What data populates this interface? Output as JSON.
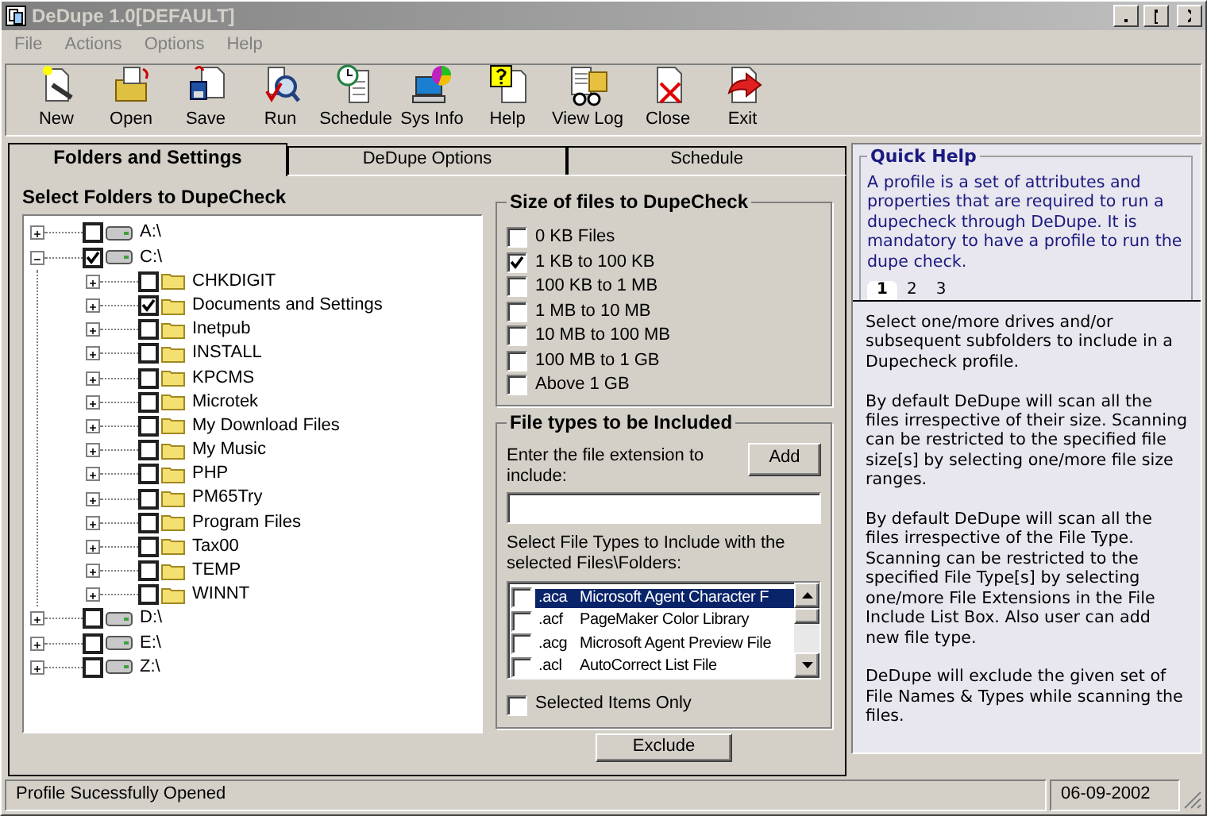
{
  "window": {
    "title": "DeDupe 1.0[DEFAULT]"
  },
  "menu": [
    "File",
    "Actions",
    "Options",
    "Help"
  ],
  "toolbar": [
    {
      "label": "New"
    },
    {
      "label": "Open"
    },
    {
      "label": "Save"
    },
    {
      "label": "Run"
    },
    {
      "label": "Schedule"
    },
    {
      "label": "Sys Info"
    },
    {
      "label": "Help"
    },
    {
      "label": "View Log"
    },
    {
      "label": "Close"
    },
    {
      "label": "Exit"
    }
  ],
  "tabs": [
    {
      "label": "Folders and Settings",
      "selected": true
    },
    {
      "label": "DeDupe Options",
      "selected": false
    },
    {
      "label": "Schedule",
      "selected": false
    }
  ],
  "folders": {
    "title": "Select Folders to DupeCheck",
    "tree": [
      {
        "label": "A:\\",
        "kind": "drive",
        "checked": false,
        "expanded": false
      },
      {
        "label": "C:\\",
        "kind": "drive",
        "checked": true,
        "expanded": true,
        "children": [
          {
            "label": "CHKDIGIT",
            "kind": "folder",
            "checked": false,
            "expanded": false
          },
          {
            "label": "Documents and Settings",
            "kind": "folder",
            "checked": true,
            "expanded": false
          },
          {
            "label": "Inetpub",
            "kind": "folder",
            "checked": false,
            "expanded": false
          },
          {
            "label": "INSTALL",
            "kind": "folder",
            "checked": false,
            "expanded": false
          },
          {
            "label": "KPCMS",
            "kind": "folder",
            "checked": false,
            "expanded": false
          },
          {
            "label": "Microtek",
            "kind": "folder",
            "checked": false,
            "expanded": false
          },
          {
            "label": "My Download Files",
            "kind": "folder",
            "checked": false,
            "expanded": false
          },
          {
            "label": "My Music",
            "kind": "folder",
            "checked": false,
            "expanded": false
          },
          {
            "label": "PHP",
            "kind": "folder",
            "checked": false,
            "expanded": false
          },
          {
            "label": "PM65Try",
            "kind": "folder",
            "checked": false,
            "expanded": false
          },
          {
            "label": "Program Files",
            "kind": "folder",
            "checked": false,
            "expanded": false
          },
          {
            "label": "Tax00",
            "kind": "folder",
            "checked": false,
            "expanded": false
          },
          {
            "label": "TEMP",
            "kind": "folder",
            "checked": false,
            "expanded": false
          },
          {
            "label": "WINNT",
            "kind": "folder",
            "checked": false,
            "expanded": false
          }
        ]
      },
      {
        "label": "D:\\",
        "kind": "drive",
        "checked": false,
        "expanded": false
      },
      {
        "label": "E:\\",
        "kind": "drive",
        "checked": false,
        "expanded": false
      },
      {
        "label": "Z:\\",
        "kind": "drive",
        "checked": false,
        "expanded": false
      }
    ]
  },
  "size_group": {
    "title": "Size of files to DupeCheck",
    "options": [
      {
        "label": "0 KB Files",
        "checked": false
      },
      {
        "label": "1 KB to 100 KB",
        "checked": true
      },
      {
        "label": "100 KB to 1 MB",
        "checked": false
      },
      {
        "label": "1 MB to 10 MB",
        "checked": false
      },
      {
        "label": "10 MB to 100 MB",
        "checked": false
      },
      {
        "label": "100 MB to 1 GB",
        "checked": false
      },
      {
        "label": "Above 1 GB",
        "checked": false
      }
    ]
  },
  "file_types": {
    "title": "File types to be Included",
    "extension_label": "Enter the file extension to include:",
    "add_button": "Add",
    "list_label": "Select File Types to Include with the selected Files\\Folders:",
    "list": [
      {
        "ext": ".aca",
        "description": "Microsoft Agent Character F",
        "checked": false,
        "selected": true
      },
      {
        "ext": ".acf",
        "description": "PageMaker Color Library",
        "checked": false,
        "selected": false
      },
      {
        "ext": ".acg",
        "description": "Microsoft Agent Preview File",
        "checked": false,
        "selected": false
      },
      {
        "ext": ".acl",
        "description": "AutoCorrect List File",
        "checked": false,
        "selected": false
      }
    ],
    "selected_only": {
      "label": "Selected Items Only",
      "checked": false
    }
  },
  "exclude_button": "Exclude",
  "quick_help": {
    "title": "Quick Help",
    "intro": "A profile is a set of attributes and properties that are required to run a dupecheck through DeDupe. It is mandatory to have a profile to run the dupe check.",
    "pages": [
      {
        "label": "1",
        "selected": true
      },
      {
        "label": "2",
        "selected": false
      },
      {
        "label": "3",
        "selected": false
      }
    ],
    "paragraphs": [
      "Select one/more drives and/or subsequent subfolders to include in a Dupecheck profile.",
      "By default DeDupe will scan all the files irrespective of their size. Scanning can be restricted to the specified file size[s] by selecting one/more file size ranges.",
      "By default DeDupe will scan all the files irrespective of the File Type. Scanning can be restricted to the specified File Type[s] by selecting one/more File Extensions in the File Include List Box. Also user can add new file type.",
      "DeDupe will exclude the given set of File Names & Types while scanning the files."
    ]
  },
  "status_bar": {
    "message": "Profile Sucessfully Opened",
    "date": "06-09-2002"
  }
}
